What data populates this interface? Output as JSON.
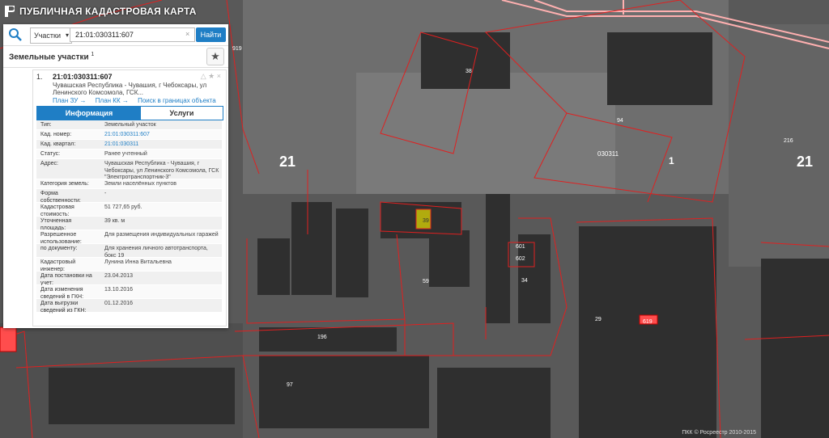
{
  "app": {
    "title": "ПУБЛИЧНАЯ КАДАСТРОВАЯ КАРТА"
  },
  "search": {
    "type_label": "Участки",
    "query": "21:01:030311:607",
    "find_label": "Найти"
  },
  "section": {
    "title": "Земельные участки",
    "count": "1"
  },
  "result": {
    "number": "1.",
    "cad_id": "21:01:030311:607",
    "address": "Чувашская Республика - Чувашия, г Чебоксары, ул Ленинского Комсомола, ГСК...",
    "links": [
      "План ЗУ →",
      "План КК →",
      "Поиск в границах объекта →"
    ]
  },
  "tabs": {
    "info": "Информация",
    "services": "Услуги"
  },
  "info_rows": [
    {
      "label": "Тип:",
      "value": "Земельный участок"
    },
    {
      "label": "Кад. номер:",
      "value": "21:01:030311:607"
    },
    {
      "label": "Кад. квартал:",
      "value": "21:01:030311"
    },
    {
      "label": "Статус:",
      "value": "Ранее учтенный"
    },
    {
      "label": "Адрес:",
      "value": "Чувашская Республика - Чувашия, г Чебоксары, ул Ленинского Комсомола, ГСК \"Электротранспортник-3\""
    },
    {
      "label": "Категория земель:",
      "value": "Земли населённых пунктов"
    },
    {
      "label": "Форма собственности:",
      "value": "-"
    },
    {
      "label": "Кадастровая стоимость:",
      "value": "51 727,65 руб."
    },
    {
      "label": "Уточненная площадь:",
      "value": "39 кв. м"
    },
    {
      "label": "Разрешенное использование:",
      "value": "Для размещения индивидуальных гаражей"
    },
    {
      "label": "по документу:",
      "value": "Для хранения личного автотранспорта, бокс 19"
    },
    {
      "label": "Кадастровый инженер:",
      "value": "Лунина Инна Витальевна"
    },
    {
      "label": "Дата постановки на учет:",
      "value": "23.04.2013"
    },
    {
      "label": "Дата изменения сведений в ГКН:",
      "value": "13.10.2016"
    },
    {
      "label": "Дата выгрузки сведений из ГКН:",
      "value": "01.12.2016"
    }
  ],
  "map_labels": {
    "q21_left": "21",
    "q21_right": "21",
    "p919": "919",
    "p38": "38",
    "p94": "94",
    "p030311": "030311",
    "p1": "1",
    "p216": "216",
    "p39": "39",
    "p59": "59",
    "p34": "34",
    "p601": "601",
    "p602": "602",
    "p29": "29",
    "p196": "196",
    "p97": "97",
    "p619": "619",
    "p1a": "1"
  },
  "copyright": "ПКК © Росреестр 2010-2015",
  "colors": {
    "parcel_line": "#e02020",
    "highlight": "#e8e000",
    "accent": "#1f7ec5"
  }
}
